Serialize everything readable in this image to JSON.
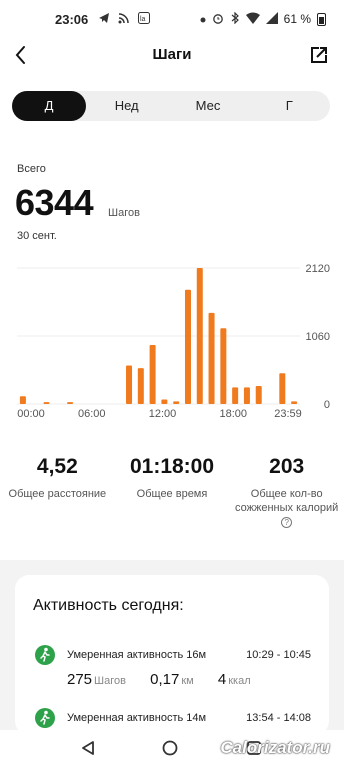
{
  "status_bar": {
    "time": "23:06",
    "left_icons": [
      "telegram-icon",
      "wifi-broadcast-icon",
      "app-icon"
    ],
    "right_icons": [
      "dot-icon",
      "alarm-icon",
      "bluetooth-icon",
      "wifi-icon",
      "signal-icon"
    ],
    "battery": "61 %"
  },
  "header": {
    "title": "Шаги"
  },
  "tabs": [
    {
      "label": "Д",
      "active": true
    },
    {
      "label": "Нед",
      "active": false
    },
    {
      "label": "Мес",
      "active": false
    },
    {
      "label": "Г",
      "active": false
    }
  ],
  "summary": {
    "label": "Всего",
    "value": "6344",
    "unit": "Шагов",
    "date": "30 сент."
  },
  "chart_data": {
    "type": "bar",
    "x": [
      0,
      1,
      2,
      3,
      4,
      5,
      6,
      7,
      8,
      9,
      10,
      11,
      12,
      13,
      14,
      15,
      16,
      17,
      18,
      19,
      20,
      21,
      22,
      23
    ],
    "values": [
      120,
      0,
      30,
      0,
      30,
      0,
      0,
      0,
      0,
      600,
      560,
      920,
      70,
      40,
      1780,
      2120,
      1420,
      1180,
      260,
      260,
      280,
      0,
      480,
      40
    ],
    "xtick_labels": [
      "00:00",
      "06:00",
      "12:00",
      "18:00",
      "23:59"
    ],
    "ytick_labels": [
      "2120",
      "1060",
      "0"
    ],
    "ylim": [
      0,
      2120
    ],
    "grid": true,
    "color": "#f07a1e"
  },
  "stats": [
    {
      "value": "4,52",
      "label": "Общее расстояние"
    },
    {
      "value": "01:18:00",
      "label": "Общее время"
    },
    {
      "value": "203",
      "label": "Общее кол-во сожженных калорий"
    }
  ],
  "activity": {
    "title": "Активность сегодня",
    "items": [
      {
        "name": "Умеренная активность 16м",
        "time": "10:29 - 10:45",
        "steps": "275",
        "steps_unit": "Шагов",
        "distance": "0,17",
        "distance_unit": "км",
        "calories": "4",
        "calories_unit": "ккал"
      },
      {
        "name": "Умеренная активность 14м",
        "time": "13:54 - 14:08"
      }
    ]
  },
  "nav": {
    "watermark": "Calorizator.ru"
  },
  "colors": {
    "accent": "#f07a1e",
    "activity": "#2ea24a",
    "tab_active": "#111111"
  }
}
